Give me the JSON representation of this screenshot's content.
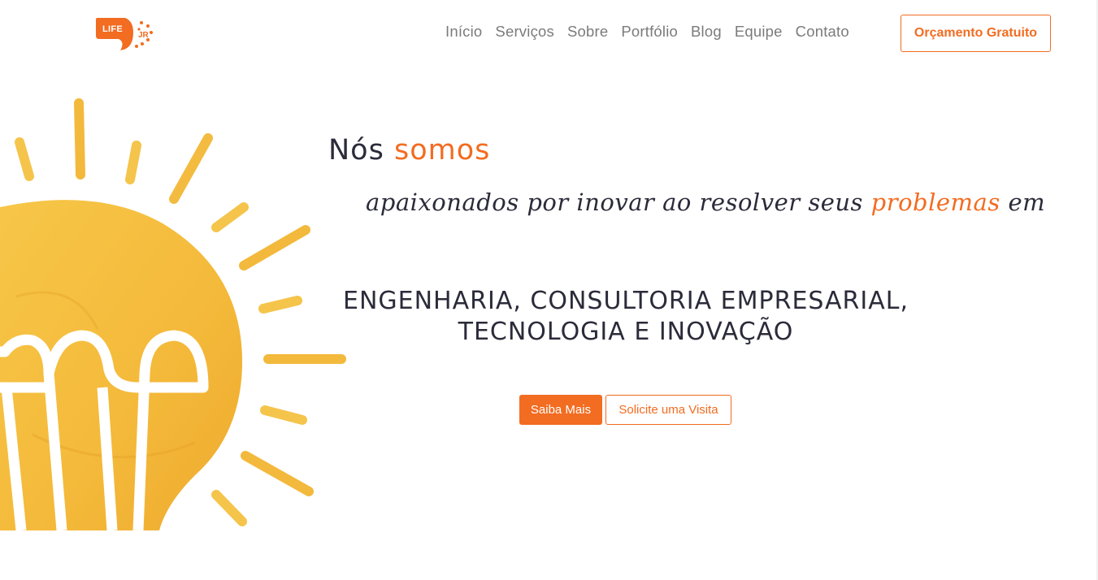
{
  "logo": {
    "text": "LIFE",
    "suffix": "JR",
    "icon": "lightbulb-leaf-logo"
  },
  "nav": {
    "items": [
      {
        "label": "Início"
      },
      {
        "label": "Serviços"
      },
      {
        "label": "Sobre"
      },
      {
        "label": "Portfólio"
      },
      {
        "label": "Blog"
      },
      {
        "label": "Equipe"
      },
      {
        "label": "Contato"
      }
    ],
    "cta_label": "Orçamento Gratuito"
  },
  "hero": {
    "intro_1": "Nós",
    "intro_2": "somos",
    "script_1": "apaixonados por inovar ao resolver seus",
    "script_accent": "problemas",
    "script_2": "em",
    "areas_line_1": "ENGENHARIA, CONSULTORIA EMPRESARIAL,",
    "areas_line_2": "TECNOLOGIA E INOVAÇÃO",
    "primary_button": "Saiba Mais",
    "secondary_button": "Solicite uma Visita",
    "illustration": "lightbulb-icon"
  },
  "colors": {
    "accent": "#f26c21",
    "text": "#2b2b3a",
    "nav_text": "#7b7b7b",
    "bulb": "#f5bd3a"
  }
}
